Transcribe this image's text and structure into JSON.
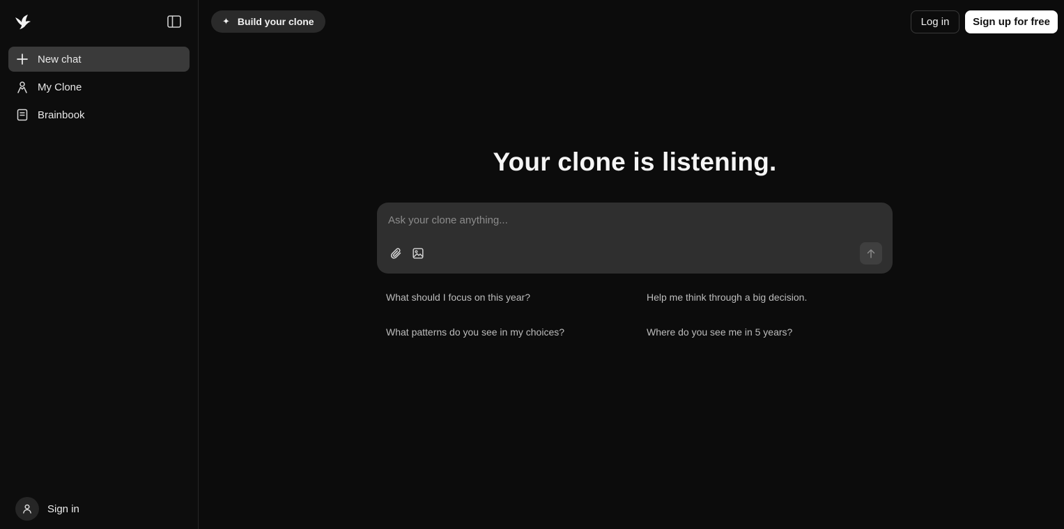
{
  "sidebar": {
    "items": [
      {
        "label": "New chat",
        "icon": "plus-icon",
        "active": true
      },
      {
        "label": "My Clone",
        "icon": "person-icon"
      },
      {
        "label": "Brainbook",
        "icon": "book-icon"
      }
    ],
    "signin_label": "Sign in"
  },
  "header": {
    "build_label": "Build your clone",
    "login_label": "Log in",
    "signup_label": "Sign up for free"
  },
  "main": {
    "headline": "Your clone is listening.",
    "input_placeholder": "Ask your clone anything...",
    "suggestions": [
      "What should I focus on this year?",
      "Help me think through a big decision.",
      "What patterns do you see in my choices?",
      "Where do you see me in 5 years?"
    ]
  },
  "colors": {
    "background": "#0c0c0c",
    "sidebar_active": "#3a3a3a",
    "composer": "#2f2f2f",
    "signup_bg": "#ffffff"
  }
}
